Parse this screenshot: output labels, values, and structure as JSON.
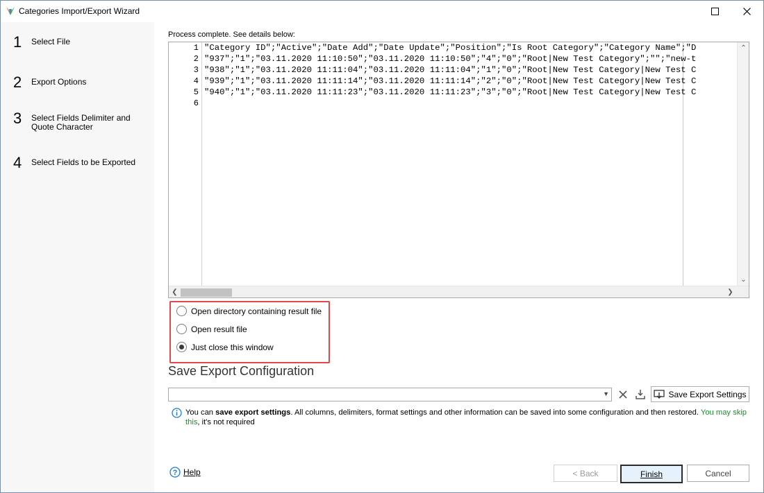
{
  "window": {
    "title": "Categories Import/Export Wizard"
  },
  "steps": [
    {
      "num": "1",
      "label": "Select File"
    },
    {
      "num": "2",
      "label": "Export Options"
    },
    {
      "num": "3",
      "label": "Select Fields Delimiter and Quote Character"
    },
    {
      "num": "4",
      "label": "Select Fields to be Exported"
    }
  ],
  "status": "Process complete. See details below:",
  "editor": {
    "line_numbers": [
      "1",
      "2",
      "3",
      "4",
      "5",
      "6"
    ],
    "lines": [
      "\"Category ID\";\"Active\";\"Date Add\";\"Date Update\";\"Position\";\"Is Root Category\";\"Category Name\";\"D",
      "\"937\";\"1\";\"03.11.2020 11:10:50\";\"03.11.2020 11:10:50\";\"4\";\"0\";\"Root|New Test Category\";\"\";\"new-t",
      "\"938\";\"1\";\"03.11.2020 11:11:04\";\"03.11.2020 11:11:04\";\"1\";\"0\";\"Root|New Test Category|New Test C",
      "\"939\";\"1\";\"03.11.2020 11:11:14\";\"03.11.2020 11:11:14\";\"2\";\"0\";\"Root|New Test Category|New Test C",
      "\"940\";\"1\";\"03.11.2020 11:11:23\";\"03.11.2020 11:11:23\";\"3\";\"0\";\"Root|New Test Category|New Test C",
      ""
    ]
  },
  "options": [
    {
      "label": "Open directory containing result file",
      "checked": false
    },
    {
      "label": "Open result file",
      "checked": false
    },
    {
      "label": "Just close this window",
      "checked": true
    }
  ],
  "save_config": {
    "title": "Save Export Configuration",
    "combo_value": "",
    "save_button": "Save Export Settings"
  },
  "info": {
    "pre": "You can ",
    "bold": "save export settings",
    "mid": ". All columns, delimiters, format settings and other information can be saved into some configuration and then restored. ",
    "green": "You may skip this",
    "post": ", it's not required"
  },
  "footer": {
    "help": "Help",
    "back": "< Back",
    "finish": "Finish",
    "cancel": "Cancel"
  },
  "colors": {
    "highlight_border": "#e0484a",
    "accent": "#1e7bd6",
    "info_green": "#1d8d2c"
  }
}
